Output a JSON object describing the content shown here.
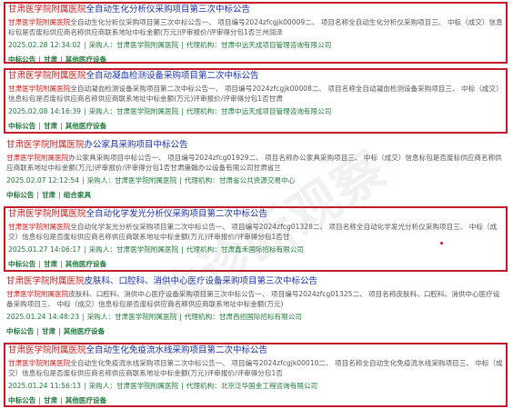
{
  "results": [
    {
      "title_hl": "甘肃医学院附属医院",
      "title_rest": "全自动生化分析仪采购项目第三次中标公告",
      "snippet_hl": "甘肃医学院附属医院",
      "snippet_rest": "全自动生化分析仪采购项目第三次中标公告一、 项目编号2024zfcgjk00009二、 项目名称全自动生化分析仪采购项目三、 中标（成交）信息标包是否废标供应商名称供应商联系地址中标金额(万元)评审报价/评审得分包1否兰州润泽",
      "date": "2025.02.28 12:34:02",
      "buyer_label": "采购人：",
      "buyer": "甘肃医学院附属医院",
      "agency_label": "代理机构：",
      "agency": "甘肃中远天成项目管理咨询有限公司",
      "tags": [
        "中标公告",
        "甘肃",
        "其他医疗设备"
      ]
    },
    {
      "title_hl": "甘肃医学院附属医院",
      "title_rest": "全自动凝血检测设备采购项目第二次中标公告",
      "snippet_hl": "甘肃医学院附属医院",
      "snippet_rest": "全自动凝血检测设备采购项目第二次中标公告一、 项目编号2024zfcgjk00008二、 项目名称全自动凝血检测设备采购项目三、 中标（成交）信息标包是否废标供应商名称供应商联系地址中标金额(万元)评审报价/评审得分包1否甘肃",
      "date": "2025.02.08 14:16:39",
      "buyer_label": "采购人：",
      "buyer": "甘肃医学院附属医院",
      "agency_label": "代理机构：",
      "agency": "甘肃中远天成项目管理咨询有限公司",
      "tags": [
        "中标公告",
        "甘肃",
        "其他医疗设备"
      ]
    },
    {
      "title_hl": "甘肃医学院附属医院",
      "title_rest": "办公家具采购项目中标公告",
      "snippet_hl": "甘肃医学院附属医院",
      "snippet_rest": "办公家具采购项目中标公告一、 项目编号2024zfcg01929二、 项目名称办公家具采购项目三、 中标（成交）信息标包是否废标供应商名称供应商联系地址中标金额(万元)评审报价/评审得分包1否甘肃雍翰办公设备有限公司甘肃省兰",
      "date": "2025.02.07 12:12:54",
      "buyer_label": "采购人：",
      "buyer": "甘肃医学院附属医院",
      "agency_label": "代理机构：",
      "agency": "甘肃省公共资源交易中心",
      "tags": [
        "中标公告",
        "甘肃",
        "组合家具"
      ]
    },
    {
      "title_hl": "甘肃医学院附属医院",
      "title_rest": "全自动化学发光分析仪采购项目第二次中标公告",
      "snippet_hl": "甘肃医学院附属医院",
      "snippet_rest": "全自动化学发光分析仪采购项目第二次中标公告一、 项目编号2024zfcg01328二、 项目名称全自动化学发光分析仪采购项目三、 中标（成交）信息标包是否废标供应商名称供应商联系地址中标金额(万元)评审报价/评审得分包1否甘",
      "date": "2025.01.27 14:06:17",
      "buyer_label": "采购人：",
      "buyer": "甘肃医学院附属医院",
      "agency_label": "代理机构：",
      "agency": "甘肃鑫禾国际招标有限公司",
      "tags": [
        "中标公告",
        "甘肃",
        "其他医疗设备"
      ]
    },
    {
      "title_hl": "甘肃医学院附属医院",
      "title_rest": "皮肤科、口腔科、消供中心医疗设备采购项目第三次中标公告",
      "snippet_hl": "甘肃医学院附属医院",
      "snippet_rest": "皮肤科、口腔科、消供中心医疗设备采购项目第三次中标公告一、 项目编号2024zfcg01325二、 项目名称皮肤科、口腔科、消供中心医疗设备采购项目三、 中标（成交）信息标包是否废标供应商名称供应商联系地址中标金额(万元)",
      "date": "2025.01.24 14:48:23",
      "buyer_label": "采购人：",
      "buyer": "甘肃医学院附属医院",
      "agency_label": "代理机构：",
      "agency": "甘肃西招国际招标有限公司",
      "tags": [
        "中标公告",
        "甘肃",
        "其他医疗设备"
      ]
    },
    {
      "title_hl": "甘肃医学院附属医院",
      "title_rest": "全自动生化免疫流水线采购项目第二次中标公告",
      "snippet_hl": "甘肃医学院附属医院",
      "snippet_rest": "全自动生化免疫流水线采购项目第二次中标公告一、 项目编号2024zfcgjk00010二、 项目名称全自动生化免疫流水线采购项目三、 中标（成交）信息标包是否废标供应商名称供应商联系地址中标金额(万元)评审报价/评审得分包1否",
      "date": "2025.01.24 11:56:13",
      "buyer_label": "采购人：",
      "buyer": "甘肃医学院附属医院",
      "agency_label": "代理机构：",
      "agency": "北京泛华国金工程咨询有限公司",
      "tags": [
        "中标公告",
        "甘肃",
        "其他医疗设备"
      ]
    }
  ],
  "watermark": "体诊断观察",
  "colors": {
    "highlight": "#d01b1b",
    "link": "#1a32a8",
    "meta": "#1f7a3a",
    "box": "#c41a2b"
  }
}
